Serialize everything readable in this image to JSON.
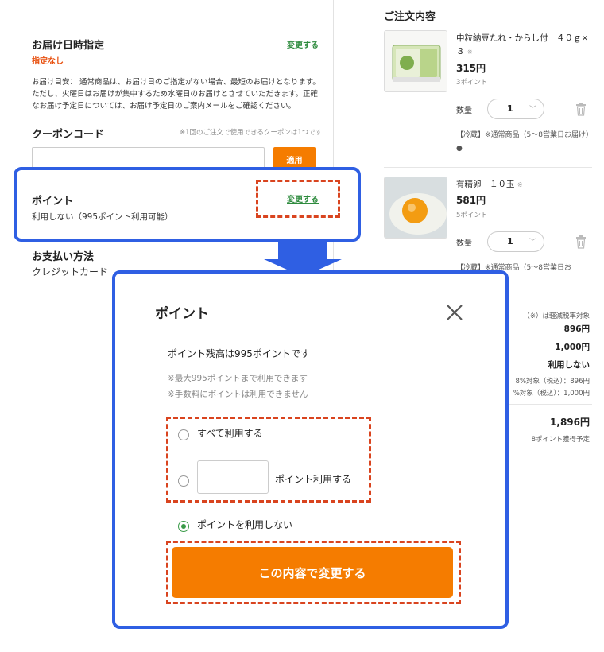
{
  "checkout": {
    "delivery": {
      "title": "お届け日時指定",
      "change": "変更する",
      "value": "指定なし",
      "guide_lines": [
        "お届け目安： 通常商品は、お届け日のご指定がない場合、最短のお届けとなります。",
        "ただし、火曜日はお届けが集中するため水曜日のお届けとさせていただきます。正確",
        "なお届け予定日については、お届け予定日のご案内メールをご確認ください。"
      ]
    },
    "coupon": {
      "title": "クーポンコード",
      "note": "※1回のご注文で使用できるクーポンは1つです",
      "apply": "適用"
    },
    "points": {
      "title": "ポイント",
      "change": "変更する",
      "value": "利用しない（995ポイント利用可能）"
    },
    "payment": {
      "title": "お支払い方法",
      "value": "クレジットカード"
    }
  },
  "order": {
    "title": "ご注文内容",
    "items": [
      {
        "name": "中粒納豆たれ・からし付　４０ｇ×３",
        "mark": "※",
        "price": "315円",
        "points": "3ポイント",
        "qty_label": "数量",
        "qty": "1",
        "note": "【冷蔵】※通常商品（5～8営業日お届け）",
        "dot": "●"
      },
      {
        "name": "有精卵　１０玉",
        "mark": "※",
        "price": "581円",
        "points": "5ポイント",
        "qty_label": "数量",
        "qty": "1",
        "note": "【冷蔵】※通常商品（5～8営業日お"
      }
    ],
    "summary": {
      "reduced_note": "（※）は軽減税率対象",
      "subtotal": "896円",
      "shipping": "1,000円",
      "points_use": "利用しない",
      "tax1": "8%対象（税込）：896円",
      "tax2": "%対象（税込）：1,000円",
      "total": "1,896円",
      "earned": "8ポイント獲得予定"
    }
  },
  "modal": {
    "title": "ポイント",
    "balance": "ポイント残高は995ポイントです",
    "notes": [
      "※最大995ポイントまで利用できます",
      "※手数料にポイントは利用できません"
    ],
    "options": {
      "all": "すべて利用する",
      "partial": "ポイント利用する",
      "none": "ポイントを利用しない"
    },
    "points_value": "",
    "submit": "この内容で変更する"
  },
  "colors": {
    "accent_orange": "#f57c00",
    "link_green": "#2e8b3e",
    "highlight_blue": "#2f5fe3",
    "dash_red": "#d9441f",
    "alert_red": "#e8500f"
  },
  "icons": [
    "close-icon",
    "trash-icon",
    "chevron-down-icon",
    "radio-icon"
  ]
}
